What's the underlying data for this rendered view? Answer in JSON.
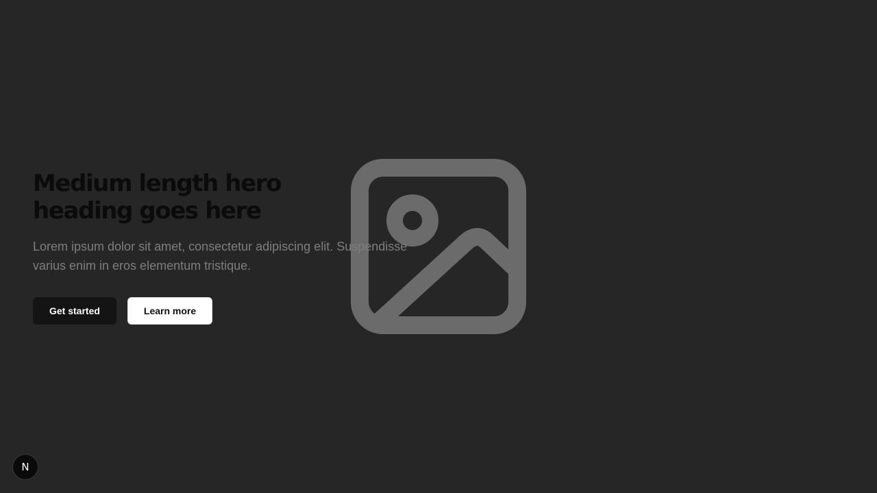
{
  "hero": {
    "heading": "Medium length hero heading goes here",
    "description": "Lorem ipsum dolor sit amet, consectetur adipiscing elit. Suspendisse varius enim in eros elementum tristique.",
    "primary_button": "Get started",
    "secondary_button": "Learn more",
    "image_icon": "image-placeholder-icon"
  },
  "badge": {
    "letter": "N",
    "icon": "nextjs-icon"
  },
  "colors": {
    "background": "#262626",
    "heading": "#0b0b0b",
    "body_text": "#7e7e7e",
    "primary_button_bg": "#141414",
    "secondary_button_bg": "#ffffff",
    "placeholder_icon": "#6b6b6b"
  }
}
